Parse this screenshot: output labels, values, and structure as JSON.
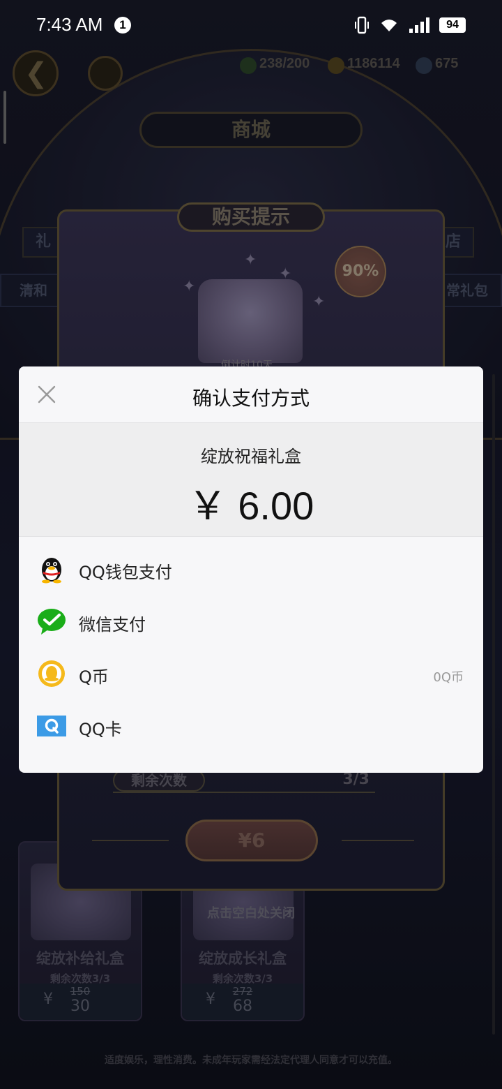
{
  "status_bar": {
    "time": "7:43 AM",
    "notification_count": "1",
    "battery": "94"
  },
  "game": {
    "resources": {
      "stamina": "238/200",
      "gold": "1186114",
      "crystal": "675"
    },
    "shop_title": "商城",
    "tabs": {
      "top_left": "礼",
      "top_right": "店",
      "left": "清和",
      "right": "常礼包"
    },
    "purchase_prompt": {
      "title": "购买提示",
      "discount": "90%",
      "countdown": "倒计时10天",
      "remaining_label": "剩余次数",
      "remaining_value": "3/3",
      "buy_price": "¥6"
    },
    "cards": [
      {
        "name": "绽放补给礼盒",
        "remaining": "剩余次数3/3",
        "currency": "¥",
        "old_price": "150",
        "new_price": "30"
      },
      {
        "name": "绽放成长礼盒",
        "remaining": "剩余次数3/3",
        "currency": "¥",
        "old_price": "272",
        "new_price": "68"
      }
    ],
    "close_hint": "点击空白处关闭",
    "disclaimer": "适度娱乐，理性消费。未成年玩家需经法定代理人同意才可以充值。"
  },
  "payment_dialog": {
    "title": "确认支付方式",
    "product_name": "绽放祝福礼盒",
    "amount": "￥ 6.00",
    "methods": [
      {
        "label": "QQ钱包支付",
        "icon": "qq-penguin-icon",
        "extra": ""
      },
      {
        "label": "微信支付",
        "icon": "wechat-pay-icon",
        "extra": ""
      },
      {
        "label": "Q币",
        "icon": "q-coin-icon",
        "extra": "0Q币"
      },
      {
        "label": "QQ卡",
        "icon": "qq-card-icon",
        "extra": ""
      }
    ]
  },
  "colors": {
    "wechat_green": "#1aad19",
    "qcoin_yellow": "#f5b91b",
    "qq_card_blue": "#3c9be6"
  }
}
